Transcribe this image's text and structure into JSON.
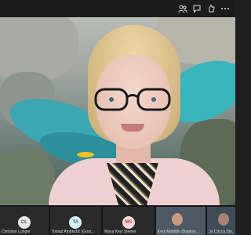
{
  "toolbar": {
    "buttons": [
      {
        "icon": "people-icon"
      },
      {
        "icon": "chat-icon"
      },
      {
        "icon": "reactions-icon"
      },
      {
        "icon": "more-icon"
      }
    ]
  },
  "participants": [
    {
      "initials": "CL",
      "name": "Christian Lunger",
      "avatar_bg": "#e8e8e8",
      "avatar_fg": "#5b5b5b"
    },
    {
      "initials": "TA",
      "name": "Tomaž Ambrožič (Gost...",
      "avatar_bg": "#d9eef1",
      "avatar_fg": "#3b7480"
    },
    {
      "initials": "MS",
      "name": "Maya Keyi Steiner",
      "avatar_bg": "#f5d9da",
      "avatar_fg": "#a34c53"
    },
    {
      "name": "Kırış Muhittin (Başkan...",
      "video": true
    },
    {
      "name": "Ja Cricca Sto...",
      "video": true
    }
  ]
}
